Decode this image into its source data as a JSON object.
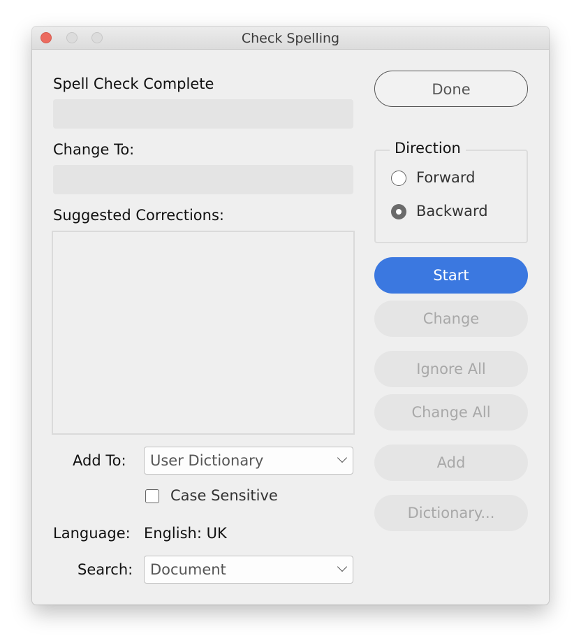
{
  "window": {
    "title": "Check Spelling"
  },
  "form": {
    "status_label": "Spell Check Complete",
    "status_value": "",
    "change_to_label": "Change To:",
    "change_to_value": "",
    "suggestions_label": "Suggested Corrections:",
    "suggestions": [],
    "add_to_label": "Add To:",
    "add_to_value": "User Dictionary",
    "case_sensitive_label": "Case Sensitive",
    "case_sensitive_checked": false,
    "language_label": "Language:",
    "language_value": "English: UK",
    "search_label": "Search:",
    "search_value": "Document"
  },
  "direction": {
    "legend": "Direction",
    "options": [
      {
        "label": "Forward",
        "selected": false
      },
      {
        "label": "Backward",
        "selected": true
      }
    ]
  },
  "buttons": {
    "done": "Done",
    "start": "Start",
    "change": "Change",
    "ignore_all": "Ignore All",
    "change_all": "Change All",
    "add": "Add",
    "dictionary": "Dictionary..."
  },
  "colors": {
    "accent": "#3b78e0",
    "close": "#ec6b5f"
  }
}
